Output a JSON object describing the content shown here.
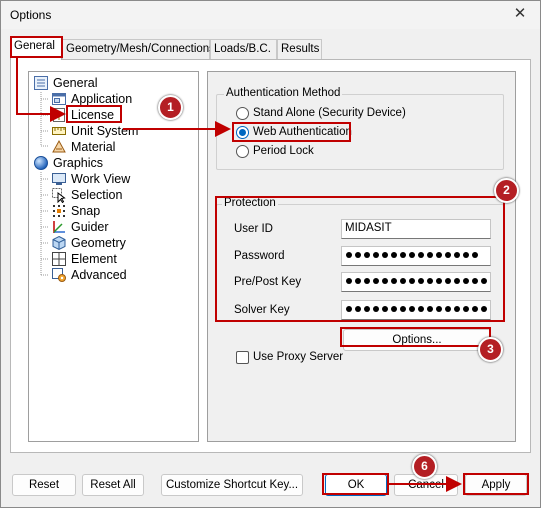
{
  "window": {
    "title": "Options",
    "close_glyph": "✕"
  },
  "tabs": [
    {
      "label": "General",
      "active": true
    },
    {
      "label": "Geometry/Mesh/Connections",
      "active": false
    },
    {
      "label": "Loads/B.C.",
      "active": false
    },
    {
      "label": "Results",
      "active": false
    }
  ],
  "tree": {
    "items": [
      {
        "label": "General",
        "icon": "tree-root-icon",
        "selected": false
      },
      {
        "label": "Application",
        "icon": "application-window-icon",
        "selected": false
      },
      {
        "label": "License",
        "icon": "license-key-icon",
        "selected": true
      },
      {
        "label": "Unit System",
        "icon": "unit-system-icon",
        "selected": false
      },
      {
        "label": "Material",
        "icon": "material-icon",
        "selected": false
      },
      {
        "label": "Graphics",
        "icon": "graphics-sphere-icon",
        "selected": false
      },
      {
        "label": "Work View",
        "icon": "work-view-icon",
        "selected": false
      },
      {
        "label": "Selection",
        "icon": "selection-cursor-icon",
        "selected": false
      },
      {
        "label": "Snap",
        "icon": "snap-icon",
        "selected": false
      },
      {
        "label": "Guider",
        "icon": "guider-icon",
        "selected": false
      },
      {
        "label": "Geometry",
        "icon": "geometry-cube-icon",
        "selected": false
      },
      {
        "label": "Element",
        "icon": "element-icon",
        "selected": false
      },
      {
        "label": "Advanced",
        "icon": "advanced-gear-icon",
        "selected": false
      }
    ]
  },
  "auth": {
    "title": "Authentication Method",
    "options": [
      {
        "label": "Stand Alone (Security Device)",
        "checked": false
      },
      {
        "label": "Web Authentication",
        "checked": true
      },
      {
        "label": "Period Lock",
        "checked": false
      }
    ]
  },
  "protection": {
    "title": "Protection",
    "user_id_label": "User ID",
    "user_id_value": "MIDASIT",
    "password_label": "Password",
    "prepost_label": "Pre/Post Key",
    "solver_label": "Solver Key",
    "masked": {
      "password": 15,
      "prepost": 16,
      "solver": 16
    }
  },
  "options_button": "Options...",
  "proxy": {
    "label": "Use Proxy Server",
    "checked": false
  },
  "footer": {
    "reset": "Reset",
    "reset_all": "Reset All",
    "shortcut": "Customize Shortcut Key...",
    "ok": "OK",
    "cancel": "Cancel",
    "apply": "Apply"
  },
  "annotations": {
    "badges": [
      "1",
      "2",
      "3",
      "6"
    ],
    "color": "#c00000"
  },
  "colors": {
    "accent": "#0067c0",
    "highlight": "#c00000",
    "badge": "#b41f24"
  }
}
